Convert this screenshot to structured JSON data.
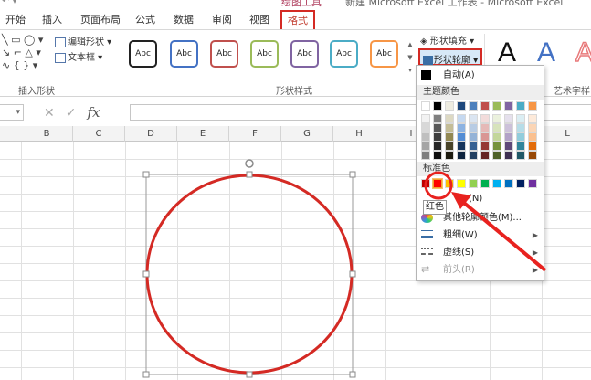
{
  "titlebar": {
    "context_tab": "绘图工具",
    "doc_title": "新建 Microsoft Excel 工作表 - Microsoft Excel"
  },
  "tabs": [
    "开始",
    "插入",
    "页面布局",
    "公式",
    "数据",
    "审阅",
    "视图",
    "格式"
  ],
  "active_tab": "格式",
  "ribbon": {
    "insert_shapes": {
      "label": "插入形状",
      "edit_shape": "编辑形状",
      "textbox": "文本框"
    },
    "shape_styles": {
      "label": "形状样式",
      "samples": [
        {
          "text": "Abc",
          "color": "#222222"
        },
        {
          "text": "Abc",
          "color": "#4472C4"
        },
        {
          "text": "Abc",
          "color": "#C0504D"
        },
        {
          "text": "Abc",
          "color": "#9BBB59"
        },
        {
          "text": "Abc",
          "color": "#8064A2"
        },
        {
          "text": "Abc",
          "color": "#4BACC6"
        },
        {
          "text": "Abc",
          "color": "#F79646"
        }
      ],
      "fill_button": "形状填充",
      "outline_button": "形状轮廓"
    },
    "wordart": {
      "label": "艺术字样",
      "letters": [
        {
          "text": "A",
          "color": "#111111"
        },
        {
          "text": "A",
          "color": "#4472C4"
        },
        {
          "text": "A",
          "color": "#E8797A"
        }
      ]
    }
  },
  "formula_bar": {
    "fx": "fx"
  },
  "columns": [
    "B",
    "C",
    "D",
    "E",
    "F",
    "G",
    "H",
    "I",
    "",
    "",
    "L"
  ],
  "dropdown": {
    "auto_item": "自动(A)",
    "theme_colors_header": "主题颜色",
    "theme_top_row": [
      "#FFFFFF",
      "#000000",
      "#EEECE1",
      "#1F497D",
      "#4F81BD",
      "#C0504D",
      "#9BBB59",
      "#8064A2",
      "#4BACC6",
      "#F79646"
    ],
    "theme_shades": [
      [
        "#F2F2F2",
        "#7F7F7F",
        "#DDD9C3",
        "#C6D9F0",
        "#DBE5F1",
        "#F2DCDB",
        "#EBF1DD",
        "#E5E0EC",
        "#DBEEF3",
        "#FDEADA"
      ],
      [
        "#D8D8D8",
        "#595959",
        "#C4BD97",
        "#8DB3E2",
        "#B8CCE4",
        "#E5B9B7",
        "#D7E3BC",
        "#CCC1D9",
        "#B7DDE8",
        "#FBD5B5"
      ],
      [
        "#BFBFBF",
        "#3F3F3F",
        "#938953",
        "#548DD4",
        "#95B3D7",
        "#D99694",
        "#C3D69B",
        "#B2A2C7",
        "#92CDDC",
        "#FAC08F"
      ],
      [
        "#A5A5A5",
        "#262626",
        "#494429",
        "#17365D",
        "#366092",
        "#953734",
        "#76923C",
        "#5F497A",
        "#31859B",
        "#E36C09"
      ],
      [
        "#7F7F7F",
        "#0C0C0C",
        "#1D1B10",
        "#0F243E",
        "#244061",
        "#632423",
        "#4F6128",
        "#3F3151",
        "#205867",
        "#974806"
      ]
    ],
    "standard_colors_header": "标准色",
    "standard_colors": [
      "#C00000",
      "#FF0000",
      "#FFC000",
      "#FFFF00",
      "#92D050",
      "#00B050",
      "#00B0F0",
      "#0070C0",
      "#002060",
      "#7030A0"
    ],
    "selected_standard_index": 1,
    "tooltip": "红色",
    "no_outline_partial": "(N)",
    "more_colors": "其他轮廓颜色(M)...",
    "weight": "粗细(W)",
    "dashes": "虚线(S)",
    "arrows": "前头(R)"
  },
  "shape": {
    "type": "ellipse",
    "outline_color": "#D42A24",
    "fill": "none"
  },
  "annotation": {
    "color": "#E8221F"
  }
}
